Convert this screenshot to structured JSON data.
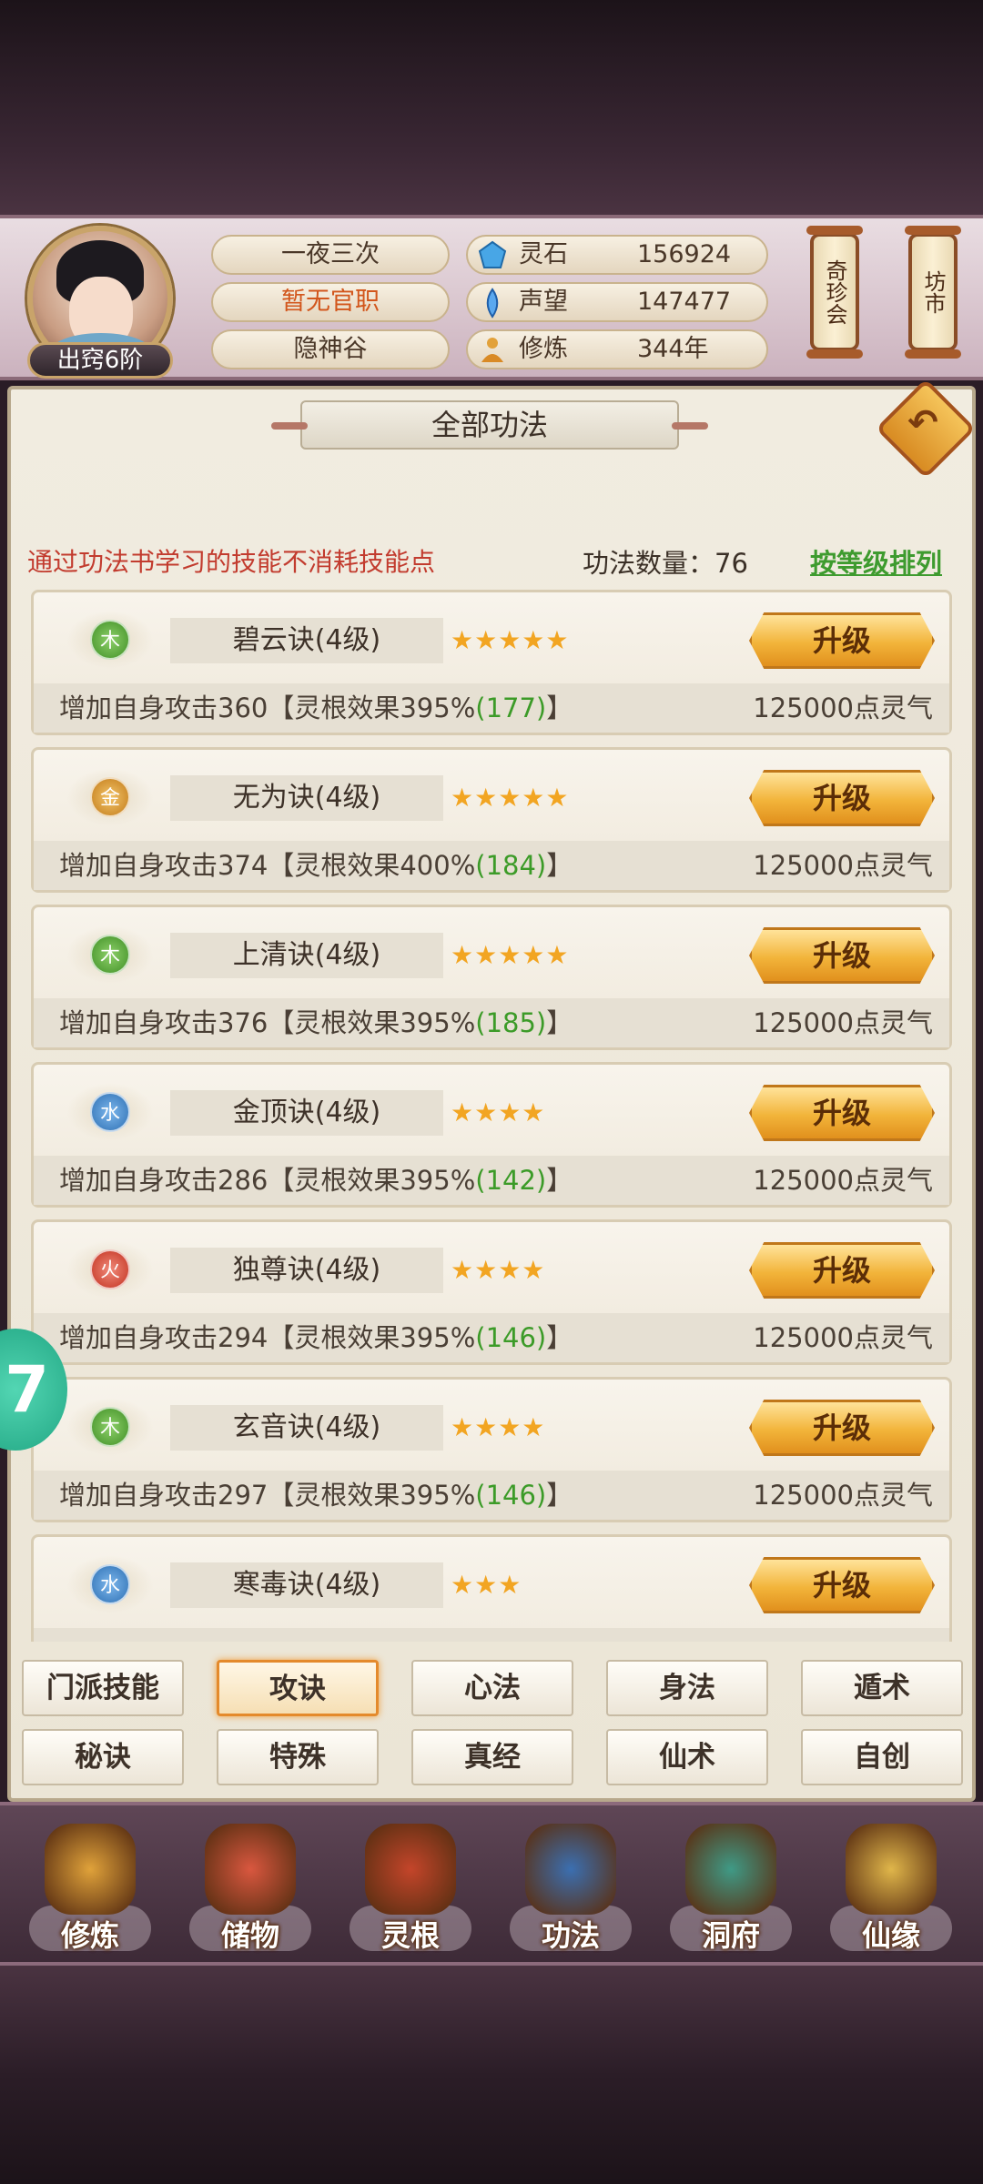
{
  "header": {
    "rank_badge": "出窍6阶",
    "player_name": "一夜三次",
    "official_title": "暂无官职",
    "sect": "隐神谷",
    "resources": [
      {
        "icon": "spirit-stone-icon",
        "label": "灵石",
        "value": "156924"
      },
      {
        "icon": "prestige-icon",
        "label": "声望",
        "value": "147477"
      },
      {
        "icon": "cultivation-icon",
        "label": "修炼",
        "value": "344年"
      }
    ],
    "shortcuts": [
      {
        "label": "奇珍会"
      },
      {
        "label": "坊市"
      }
    ]
  },
  "panel": {
    "title": "全部功法",
    "notice": "通过功法书学习的技能不消耗技能点",
    "count_label": "功法数量：76",
    "sort_label": "按等级排列"
  },
  "skills": [
    {
      "element": "木",
      "element_type": "wood",
      "name": "碧云诀(4级)",
      "stars": "★★★★★",
      "button": "升级",
      "desc_prefix": "增加自身攻击360【灵根效果395%",
      "desc_green": "(177)",
      "desc_suffix": "】",
      "cost": "125000点灵气"
    },
    {
      "element": "金",
      "element_type": "metal",
      "name": "无为诀(4级)",
      "stars": "★★★★★",
      "button": "升级",
      "desc_prefix": "增加自身攻击374【灵根效果400%",
      "desc_green": "(184)",
      "desc_suffix": "】",
      "cost": "125000点灵气"
    },
    {
      "element": "木",
      "element_type": "wood",
      "name": "上清诀(4级)",
      "stars": "★★★★★",
      "button": "升级",
      "desc_prefix": "增加自身攻击376【灵根效果395%",
      "desc_green": "(185)",
      "desc_suffix": "】",
      "cost": "125000点灵气"
    },
    {
      "element": "水",
      "element_type": "water",
      "name": "金顶诀(4级)",
      "stars": "★★★★",
      "button": "升级",
      "desc_prefix": "增加自身攻击286【灵根效果395%",
      "desc_green": "(142)",
      "desc_suffix": "】",
      "cost": "125000点灵气"
    },
    {
      "element": "火",
      "element_type": "fire",
      "name": "独尊诀(4级)",
      "stars": "★★★★",
      "button": "升级",
      "desc_prefix": "增加自身攻击294【灵根效果395%",
      "desc_green": "(146)",
      "desc_suffix": "】",
      "cost": "125000点灵气"
    },
    {
      "element": "木",
      "element_type": "wood",
      "name": "玄音诀(4级)",
      "stars": "★★★★",
      "button": "升级",
      "desc_prefix": "增加自身攻击297【灵根效果395%",
      "desc_green": "(146)",
      "desc_suffix": "】",
      "cost": "125000点灵气"
    },
    {
      "element": "水",
      "element_type": "water",
      "name": "寒毒诀(4级)",
      "stars": "★★★",
      "button": "升级",
      "desc_prefix": "",
      "desc_green": "",
      "desc_suffix": "",
      "cost": ""
    }
  ],
  "floating_button": "7",
  "category_tabs": [
    {
      "label": "门派技能",
      "active": false
    },
    {
      "label": "攻诀",
      "active": true
    },
    {
      "label": "心法",
      "active": false
    },
    {
      "label": "身法",
      "active": false
    },
    {
      "label": "遁术",
      "active": false
    },
    {
      "label": "秘诀",
      "active": false
    },
    {
      "label": "特殊",
      "active": false
    },
    {
      "label": "真经",
      "active": false
    },
    {
      "label": "仙术",
      "active": false
    },
    {
      "label": "自创",
      "active": false
    }
  ],
  "bottom_nav": [
    {
      "label": "修炼",
      "icon": "cultivate-monk-icon",
      "color": "#e0a23a"
    },
    {
      "label": "储物",
      "icon": "storage-bag-icon",
      "color": "#d9573f"
    },
    {
      "label": "灵根",
      "icon": "spirit-root-icon",
      "color": "#c4452a"
    },
    {
      "label": "功法",
      "icon": "skill-book-icon",
      "color": "#3b6fb1"
    },
    {
      "label": "洞府",
      "icon": "cave-house-icon",
      "color": "#3f9a86"
    },
    {
      "label": "仙缘",
      "icon": "gourd-icon",
      "color": "#e0b64a"
    }
  ]
}
